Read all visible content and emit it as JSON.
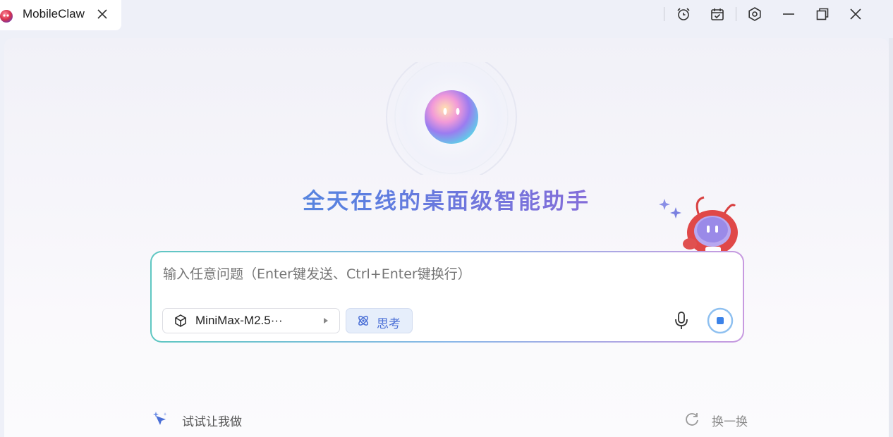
{
  "window": {
    "tab_title": "MobileClaw",
    "controls": [
      "alarm-clock-icon",
      "calendar-check-icon",
      "settings-icon",
      "minimize-icon",
      "restore-icon",
      "close-icon"
    ]
  },
  "hero": {
    "headline": "全天在线的桌面级智能助手"
  },
  "composer": {
    "placeholder": "输入任意问题（Enter键发送、Ctrl+Enter键换行）",
    "model_label": "MiniMax-M2.5···",
    "think_label": "思考"
  },
  "suggestions": {
    "label": "试试让我做",
    "refresh_label": "换一换"
  },
  "colors": {
    "accent": "#4a6fd6",
    "headline_start": "#3d9fd8",
    "headline_end": "#b86ad0",
    "think_bg": "#e6eefb"
  }
}
